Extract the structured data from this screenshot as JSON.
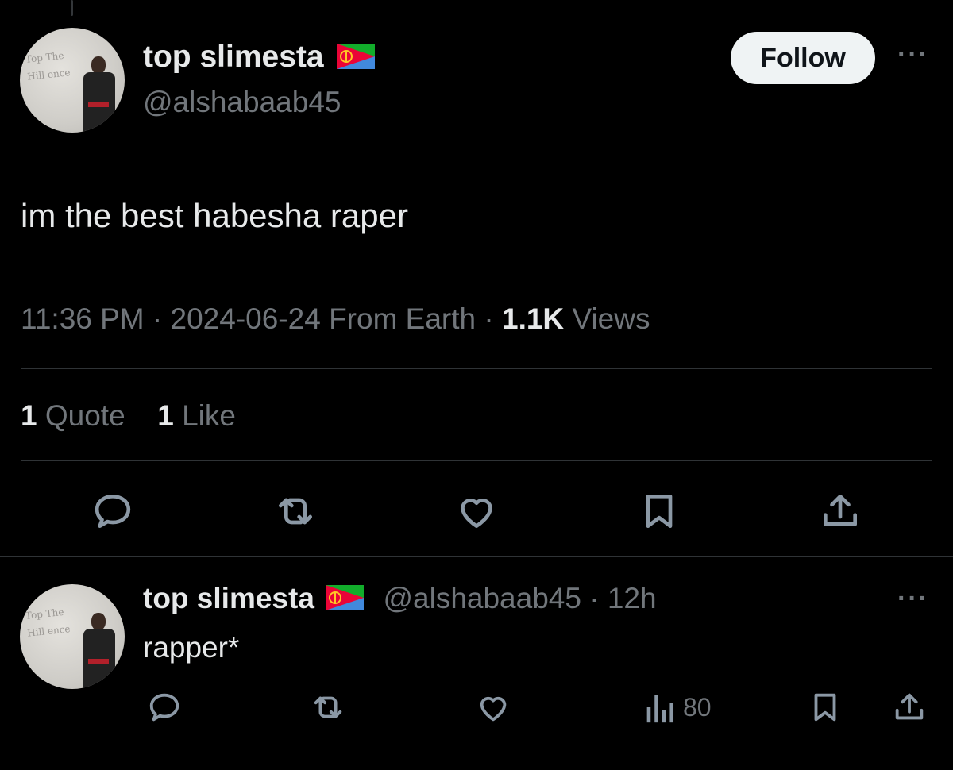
{
  "main_tweet": {
    "author": {
      "name": "top slimesta",
      "handle": "@alshabaab45",
      "avatar_text": "Top The\nHill ence"
    },
    "follow_label": "Follow",
    "more_label": "···",
    "text": "im the best habesha raper",
    "time": "11:36 PM",
    "sep": " · ",
    "date": "2024-06-24",
    "source": "From Earth",
    "views_count": "1.1K",
    "views_label": "Views",
    "quotes_count": "1",
    "quotes_label": "Quote",
    "likes_count": "1",
    "likes_label": "Like",
    "actions": [
      "reply-icon",
      "retweet-icon",
      "like-icon",
      "bookmark-icon",
      "share-icon"
    ]
  },
  "reply_tweet": {
    "author": {
      "name": "top slimesta",
      "handle": "@alshabaab45",
      "avatar_text": "Top The\nHill ence"
    },
    "sep": "·",
    "time_ago": "12h",
    "text": "rapper*",
    "more_label": "···",
    "views": "80",
    "actions": [
      "reply-icon",
      "retweet-icon",
      "like-icon",
      "views-icon",
      "bookmark-icon",
      "share-icon"
    ]
  },
  "colors": {
    "background": "#000000",
    "primary_text": "#e7e9ea",
    "secondary_text": "#71767b",
    "divider": "#2f3336",
    "follow_bg": "#eff3f4"
  }
}
